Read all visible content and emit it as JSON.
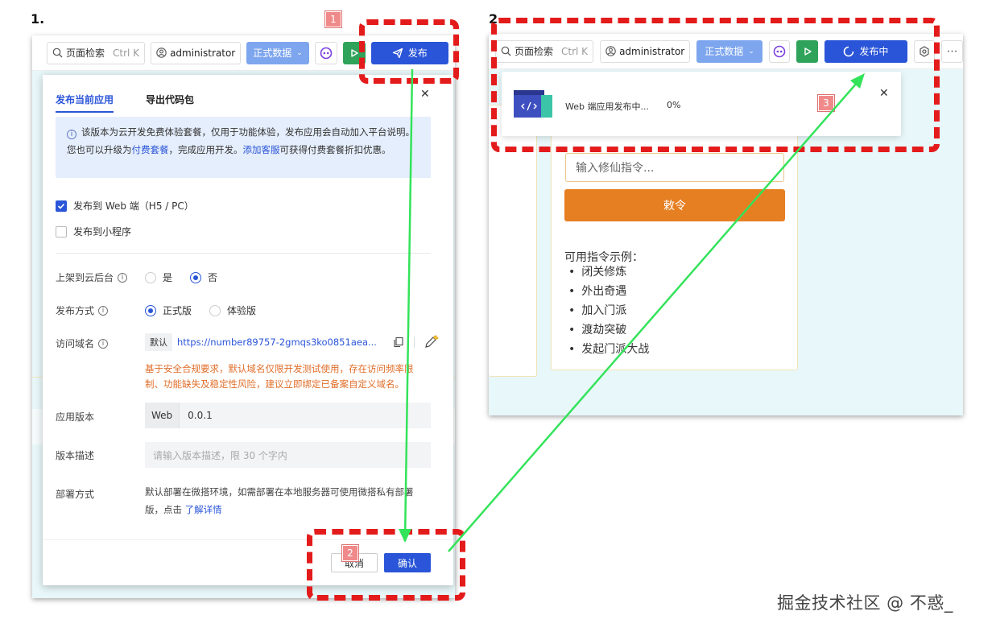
{
  "labels": {
    "step1": "1.",
    "step2": "2."
  },
  "toolbar": {
    "search_label": "页面检索",
    "search_shortcut": "Ctrl K",
    "user": "administrator",
    "env": "正式数据",
    "publish": "发布",
    "publishing": "发布中"
  },
  "dialog": {
    "tab_active": "发布当前应用",
    "tab_export": "导出代码包",
    "notice_before_link1": "该版本为云开发免费体验套餐，仅用于功能体验，发布应用会自动加入平台说明。您也可以升级为",
    "notice_link1": "付费套餐",
    "notice_mid": "，完成应用开发。",
    "notice_link2": "添加客服",
    "notice_after": "可获得付费套餐折扣优惠。",
    "check_web": "发布到 Web 端（H5 / PC）",
    "check_mini": "发布到小程序",
    "shelf_label": "上架到云后台",
    "shelf_yes": "是",
    "shelf_no": "否",
    "mode_label": "发布方式",
    "mode_official": "正式版",
    "mode_trial": "体验版",
    "domain_label": "访问域名",
    "domain_tag": "默认",
    "domain_url": "https://number89757-2gmqs3ko0851aea...",
    "domain_warning": "基于安全合规要求，默认域名仅限开发测试使用，存在访问频率限制、功能缺失及稳定性风险，建议立即绑定已备案自定义域名。",
    "version_label": "应用版本",
    "version_prefix": "Web",
    "version_value": "0.0.1",
    "desc_label": "版本描述",
    "desc_placeholder": "请输入版本描述，限 30 个字内",
    "deploy_label": "部署方式",
    "deploy_text": "默认部署在微搭环境，如需部署在本地服务器可使用微搭私有部署版，点击 ",
    "deploy_link": "了解详情",
    "cancel": "取消",
    "confirm": "确认"
  },
  "app": {
    "input_placeholder": "输入修仙指令...",
    "button": "敕令",
    "list_title": "可用指令示例：",
    "commands": [
      "闭关修炼",
      "外出奇遇",
      "加入门派",
      "渡劫突破",
      "发起门派大战"
    ]
  },
  "popup": {
    "text": "Web 端应用发布中...",
    "percent": "0%"
  },
  "badges": [
    "1",
    "2",
    "3"
  ],
  "watermark": "掘金技术社区 @ 不惑_",
  "colors": {
    "primary": "#2a55d8",
    "annotation_red": "#e31b1b",
    "arrow_green": "#33e35a",
    "warn_orange": "#e06e2a",
    "app_button": "#e67e22"
  }
}
